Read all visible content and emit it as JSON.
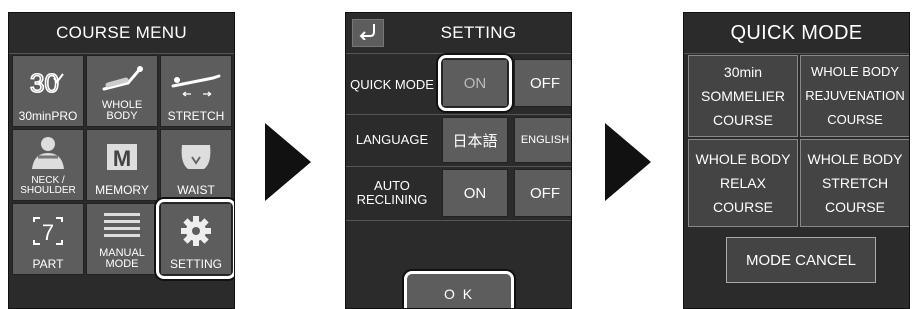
{
  "screen1": {
    "title": "COURSE MENU",
    "items": [
      {
        "label": "30minPRO",
        "icon": "30-minute-icon"
      },
      {
        "label": "WHOLE BODY",
        "icon": "reclining-body-icon"
      },
      {
        "label": "STRETCH",
        "icon": "stretch-icon"
      },
      {
        "label": "NECK / SHOULDER",
        "icon": "neck-shoulder-icon"
      },
      {
        "label": "MEMORY",
        "icon": "memory-m-icon"
      },
      {
        "label": "WAIST",
        "icon": "waist-icon"
      },
      {
        "label": "PART",
        "icon": "part-bracket-7-icon"
      },
      {
        "label": "MANUAL MODE",
        "icon": "manual-lines-icon"
      },
      {
        "label": "SETTING",
        "icon": "gear-icon"
      }
    ],
    "icon_text_30": "30",
    "icon_text_m": "M",
    "icon_text_7": "7",
    "selected": "SETTING"
  },
  "screen2": {
    "title": "SETTING",
    "back_icon": "return-arrow-icon",
    "rows": [
      {
        "label": "QUICK MODE",
        "options": [
          "ON",
          "OFF"
        ],
        "selected": "ON"
      },
      {
        "label": "LANGUAGE",
        "options": [
          "日本語",
          "ENGLISH"
        ],
        "selected": ""
      },
      {
        "label": "AUTO RECLINING",
        "options": [
          "ON",
          "OFF"
        ],
        "selected": ""
      }
    ],
    "ok_label": "O K"
  },
  "screen3": {
    "title": "QUICK MODE",
    "courses": [
      "30min\nSOMMELIER\nCOURSE",
      "WHOLE BODY\nREJUVENATION\nCOURSE",
      "WHOLE BODY\nRELAX\nCOURSE",
      "WHOLE BODY\nSTRETCH\nCOURSE"
    ],
    "cancel_label": "MODE CANCEL"
  },
  "arrows": [
    "right-arrow-icon",
    "right-arrow-icon"
  ],
  "colors": {
    "screen_bg": "#2b2b2b",
    "button_bg": "#5d5d5d",
    "highlight": "#ffffff",
    "arrow": "#111111"
  }
}
